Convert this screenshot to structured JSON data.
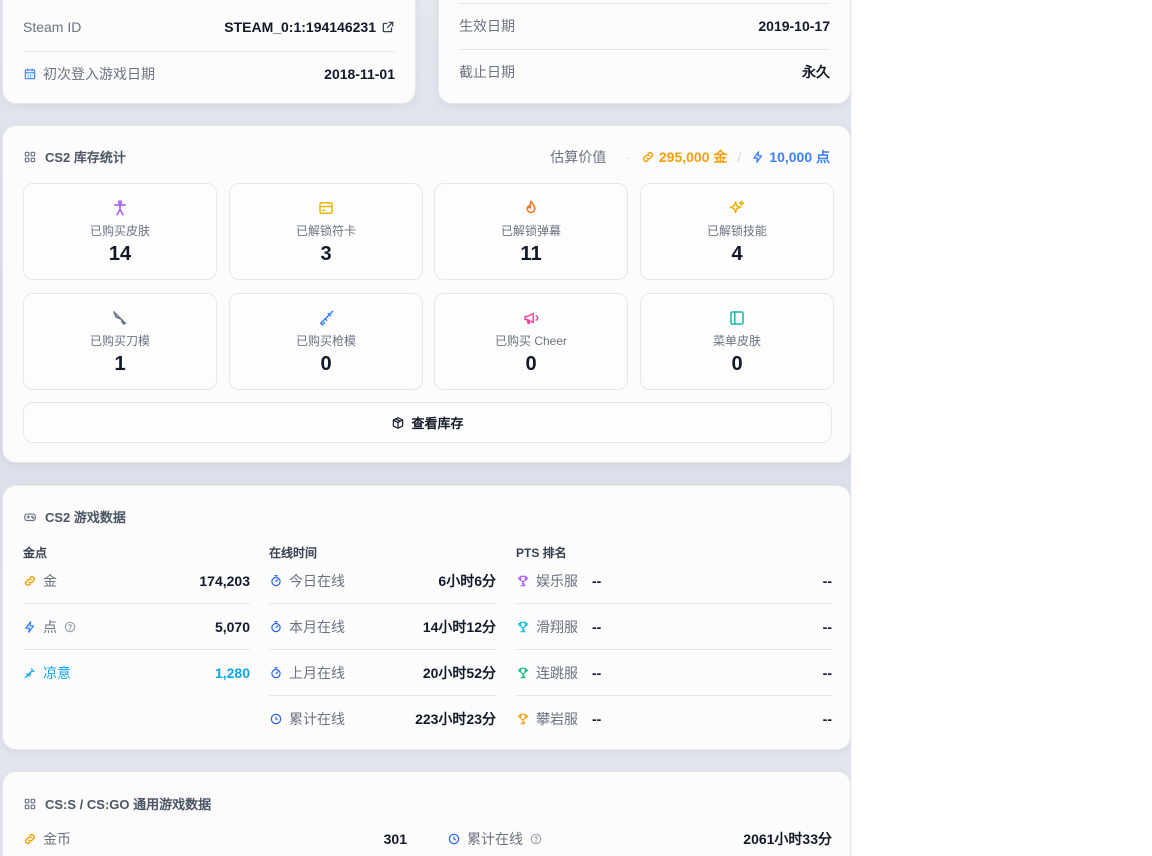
{
  "profile": {
    "steam_id_label": "Steam ID",
    "steam_id_value": "STEAM_0:1:194146231",
    "first_login_label": "初次登入游戏日期",
    "first_login_value": "2018-11-01"
  },
  "subscription": {
    "start_label": "生效日期",
    "start_value": "2019-10-17",
    "end_label": "截止日期",
    "end_value": "永久"
  },
  "inventory": {
    "title": "CS2 库存统计",
    "estimate_label": "估算价值",
    "gold_value": "295,000 金",
    "points_value": "10,000 点",
    "tiles": [
      {
        "label": "已购买皮肤",
        "value": "14",
        "icon": "person-icon",
        "color": "#a855f7"
      },
      {
        "label": "已解锁符卡",
        "value": "3",
        "icon": "card-icon",
        "color": "#eab308"
      },
      {
        "label": "已解锁弹幕",
        "value": "11",
        "icon": "flame-icon",
        "color": "#f97316"
      },
      {
        "label": "已解锁技能",
        "value": "4",
        "icon": "sparkles-icon",
        "color": "#eab308"
      },
      {
        "label": "已购买刀模",
        "value": "1",
        "icon": "knife-icon",
        "color": "#64748b"
      },
      {
        "label": "已购买枪模",
        "value": "0",
        "icon": "rifle-icon",
        "color": "#3b82f6"
      },
      {
        "label": "已购买 Cheer",
        "value": "0",
        "icon": "megaphone-icon",
        "color": "#ec4899"
      },
      {
        "label": "菜单皮肤",
        "value": "0",
        "icon": "panel-icon",
        "color": "#14b8a6"
      }
    ],
    "view_button": "查看库存"
  },
  "game": {
    "title": "CS2 游戏数据",
    "currency_head": "金点",
    "currency": [
      {
        "label": "金",
        "value": "174,203",
        "icon": "link-icon",
        "color": "#f59e0b"
      },
      {
        "label": "点",
        "value": "5,070",
        "icon": "bolt-icon",
        "color": "#3b82f6"
      },
      {
        "label": "凉意",
        "value": "1,280",
        "icon": "snowflake-icon",
        "color": "#0ea5e9"
      }
    ],
    "online_head": "在线时间",
    "online": [
      {
        "label": "今日在线",
        "value": "6小时6分",
        "icon": "timer-icon"
      },
      {
        "label": "本月在线",
        "value": "14小时12分",
        "icon": "timer-icon"
      },
      {
        "label": "上月在线",
        "value": "20小时52分",
        "icon": "timer-icon"
      },
      {
        "label": "累计在线",
        "value": "223小时23分",
        "icon": "clock-icon"
      }
    ],
    "pts_head": "PTS 排名",
    "pts": [
      {
        "label": "娱乐服",
        "mid": "--",
        "value": "--",
        "color": "#a855f7"
      },
      {
        "label": "滑翔服",
        "mid": "--",
        "value": "--",
        "color": "#06b6d4"
      },
      {
        "label": "连跳服",
        "mid": "--",
        "value": "--",
        "color": "#10b981"
      },
      {
        "label": "攀岩服",
        "mid": "--",
        "value": "--",
        "color": "#f59e0b"
      }
    ]
  },
  "legacy": {
    "title": "CS:S / CS:GO 通用游戏数据",
    "coins_label": "金币",
    "coins_value": "301",
    "online_label": "累计在线",
    "online_value": "2061小时33分"
  }
}
